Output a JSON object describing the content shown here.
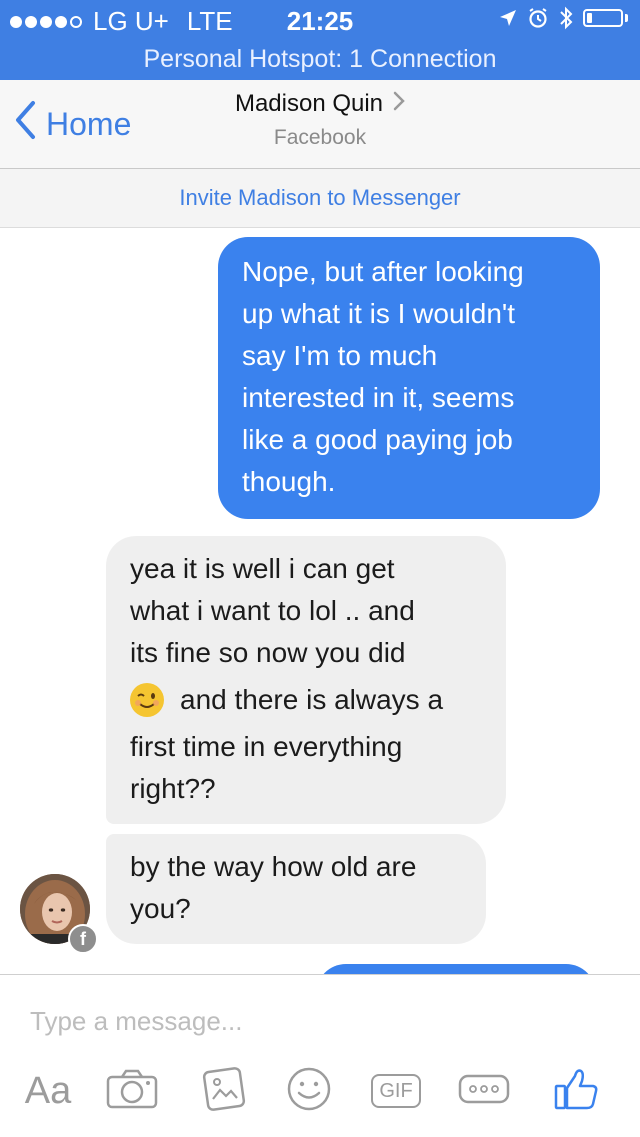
{
  "status_bar": {
    "carrier": "LG U+",
    "network": "LTE",
    "time": "21:25",
    "signal_bars_filled": 4,
    "signal_bars_total": 5,
    "battery_level": 0.15,
    "icons": [
      "location-arrow-icon",
      "alarm-clock-icon",
      "bluetooth-icon",
      "battery-icon"
    ]
  },
  "hotspot": {
    "text": "Personal Hotspot: 1 Connection"
  },
  "nav": {
    "back_label": "Home",
    "title": "Madison Quin",
    "subtitle": "Facebook"
  },
  "invite": {
    "label": "Invite Madison to Messenger"
  },
  "messages": [
    {
      "direction": "outgoing",
      "lines": [
        "Nope, but after looking",
        "up what it is I wouldn't",
        "say I'm to much",
        "interested in it, seems",
        "like a good paying job",
        "though."
      ]
    },
    {
      "direction": "incoming",
      "lines": [
        "yea it is well i can get",
        "what i want to lol .. and",
        "its fine so now you did",
        "and there is always a",
        "first time in everything",
        "right??"
      ],
      "emoji": "winking-face"
    },
    {
      "direction": "incoming",
      "lines": [
        "by the way how old are",
        "you?"
      ]
    }
  ],
  "composer": {
    "placeholder": "Type a message...",
    "toolbar_labels": {
      "text_mode": "Aa",
      "gif": "GIF"
    }
  },
  "colors": {
    "accent": "#3f7fe3",
    "outgoing_bubble": "#3a82ee",
    "incoming_bubble": "#efefef",
    "icon_gray": "#9c9c9c"
  }
}
